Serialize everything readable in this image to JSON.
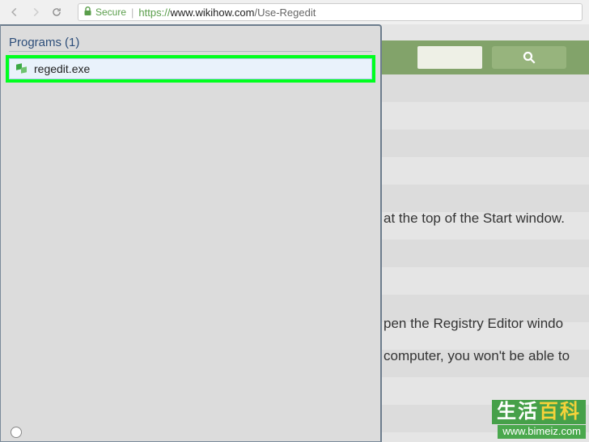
{
  "browser": {
    "secure_label": "Secure",
    "url_protocol": "https://",
    "url_domain": "www.wikihow.com",
    "url_path": "/Use-Regedit"
  },
  "start_menu": {
    "header_label": "Programs",
    "header_count": "(1)",
    "results": [
      {
        "name": "regedit.exe"
      }
    ]
  },
  "article": {
    "line1": "at the top of the Start window.",
    "line2": "pen the Registry Editor windo",
    "line3": "computer, you won't be able to"
  },
  "watermark": {
    "cn_part1": "生活",
    "cn_part2": "百科",
    "url": "www.bimeiz.com"
  }
}
